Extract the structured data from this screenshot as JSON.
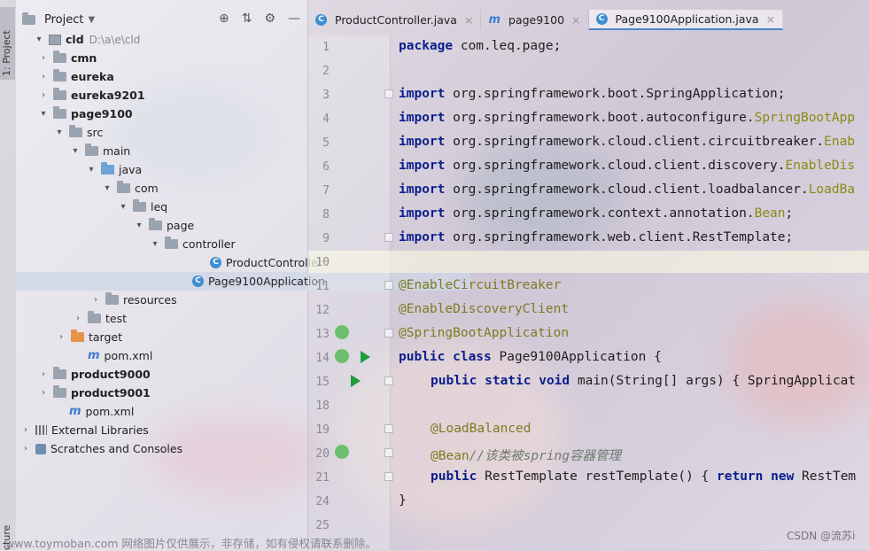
{
  "tool_strip": {
    "top_tab": "1: Project",
    "bottom_tab": "cture"
  },
  "project_panel": {
    "title": "Project",
    "tree": [
      {
        "label": "cld",
        "path": "D:\\a\\e\\cld",
        "bold": true,
        "arrow": "▾",
        "icon": "module"
      },
      {
        "label": "cmn",
        "bold": true,
        "arrow": "›",
        "icon": "folder"
      },
      {
        "label": "eureka",
        "bold": true,
        "arrow": "›",
        "icon": "folder"
      },
      {
        "label": "eureka9201",
        "bold": true,
        "arrow": "›",
        "icon": "folder"
      },
      {
        "label": "page9100",
        "bold": true,
        "arrow": "▾",
        "icon": "folder"
      },
      {
        "label": "src",
        "arrow": "▾",
        "icon": "folder"
      },
      {
        "label": "main",
        "arrow": "▾",
        "icon": "folder"
      },
      {
        "label": "java",
        "arrow": "▾",
        "icon": "folder-blue"
      },
      {
        "label": "com",
        "arrow": "▾",
        "icon": "folder"
      },
      {
        "label": "leq",
        "arrow": "▾",
        "icon": "folder"
      },
      {
        "label": "page",
        "arrow": "▾",
        "icon": "folder"
      },
      {
        "label": "controller",
        "arrow": "▾",
        "icon": "folder"
      },
      {
        "label": "ProductController",
        "arrow": "",
        "icon": "class"
      },
      {
        "label": "Page9100Application",
        "arrow": "",
        "icon": "class",
        "selected": true
      },
      {
        "label": "resources",
        "arrow": "›",
        "icon": "folder"
      },
      {
        "label": "test",
        "arrow": "›",
        "icon": "folder"
      },
      {
        "label": "target",
        "arrow": "›",
        "icon": "folder-orange"
      },
      {
        "label": "pom.xml",
        "arrow": "",
        "icon": "maven"
      },
      {
        "label": "product9000",
        "bold": true,
        "arrow": "›",
        "icon": "folder"
      },
      {
        "label": "product9001",
        "bold": true,
        "arrow": "›",
        "icon": "folder"
      },
      {
        "label": "pom.xml",
        "arrow": "",
        "icon": "maven"
      },
      {
        "label": "External Libraries",
        "arrow": "›",
        "icon": "library"
      },
      {
        "label": "Scratches and Consoles",
        "arrow": "›",
        "icon": "scratch"
      }
    ]
  },
  "tabs": [
    {
      "label": "ProductController.java",
      "icon": "class",
      "closable": true
    },
    {
      "label": "page9100",
      "icon": "maven",
      "closable": true
    },
    {
      "label": "Page9100Application.java",
      "icon": "class",
      "closable": true,
      "active": true
    }
  ],
  "editor": {
    "line_numbers": [
      "1",
      "2",
      "3",
      "4",
      "5",
      "6",
      "7",
      "8",
      "9",
      "10",
      "11",
      "12",
      "13",
      "14",
      "15",
      "18",
      "19",
      "20",
      "21",
      "24",
      "25"
    ],
    "lines": {
      "l1": {
        "kw": "package",
        "rest": " com.leq.page;"
      },
      "imports": [
        {
          "pkg": " org.springframework.boot.",
          "cls": "",
          "tail": "SpringApplication;"
        },
        {
          "pkg": " org.springframework.boot.autoconfigure.",
          "cls": "SpringBootApp",
          "tail": ""
        },
        {
          "pkg": " org.springframework.cloud.client.circuitbreaker.",
          "cls": "Enab",
          "tail": ""
        },
        {
          "pkg": " org.springframework.cloud.client.discovery.",
          "cls": "EnableDis",
          "tail": ""
        },
        {
          "pkg": " org.springframework.cloud.client.loadbalancer.",
          "cls": "LoadBa",
          "tail": ""
        },
        {
          "pkg": " org.springframework.context.annotation.",
          "cls": "Bean",
          "tail": ";"
        },
        {
          "pkg": " org.springframework.web.client.",
          "cls": "",
          "tail": "RestTemplate;"
        }
      ],
      "import_kw": "import",
      "ann1": "@EnableCircuitBreaker",
      "ann2": "@EnableDiscoveryClient",
      "ann3": "@SpringBootApplication",
      "class_decl": {
        "kw": "public class",
        "rest": " Page9100Application {"
      },
      "main_decl": {
        "kw": "public static void",
        "rest": " main(String[] args) { SpringApplicat"
      },
      "ann4": "@LoadBalanced",
      "bean_ann": "@Bean",
      "bean_comment": "//该类被spring容器管理",
      "rest_decl": {
        "kw": "public",
        "rest": " RestTemplate restTemplate() { ",
        "kw2": "return new",
        "rest2": " RestTem"
      },
      "close": "}"
    }
  },
  "watermark": "www.toymoban.com 网络图片仅供展示，非存储，如有侵权请联系删除。",
  "csdn": "CSDN @流苏i"
}
